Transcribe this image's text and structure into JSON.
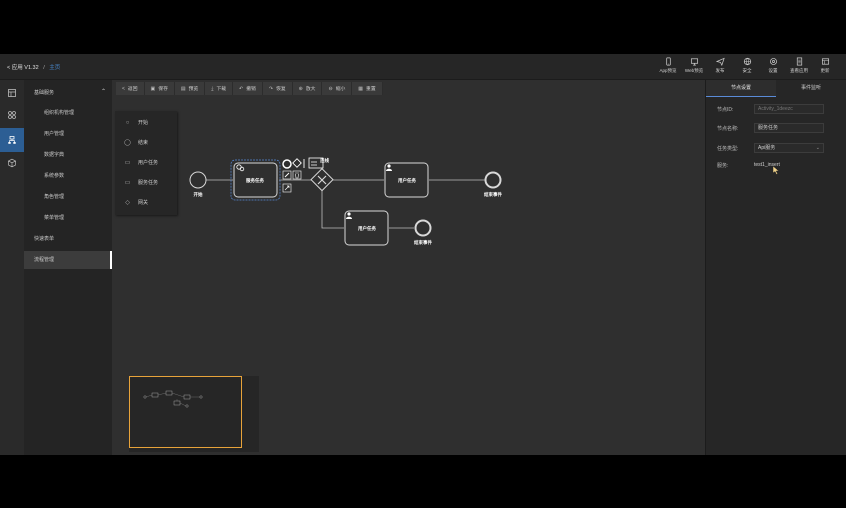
{
  "header": {
    "back_label": "< 应用",
    "version": "V1.32",
    "separator": "/",
    "tag": "主页",
    "buttons": [
      {
        "label": "App预览",
        "icon": "mobile-icon"
      },
      {
        "label": "Web预览",
        "icon": "monitor-icon"
      },
      {
        "label": "发布",
        "icon": "send-icon"
      },
      {
        "label": "安全",
        "icon": "globe-icon"
      },
      {
        "label": "设置",
        "icon": "gear-icon"
      },
      {
        "label": "查看应用",
        "icon": "document-icon"
      },
      {
        "label": "更新",
        "icon": "layout-icon"
      }
    ]
  },
  "menu": {
    "group": "基础服务",
    "items": [
      "组织机构管理",
      "用户管理",
      "数据字典",
      "系统参数",
      "角色管理",
      "菜单管理"
    ],
    "quick": "快速表单",
    "active": "流程管理"
  },
  "toolbar": [
    {
      "label": "返回",
      "icon": "<"
    },
    {
      "label": "保存",
      "icon": "▣"
    },
    {
      "label": "预览",
      "icon": "▤"
    },
    {
      "label": "下载",
      "icon": "⤓"
    },
    {
      "label": "撤销",
      "icon": "↶"
    },
    {
      "label": "恢复",
      "icon": "↷"
    },
    {
      "label": "放大",
      "icon": "⊕"
    },
    {
      "label": "缩小",
      "icon": "⊖"
    },
    {
      "label": "重置",
      "icon": "▦"
    }
  ],
  "palette": [
    {
      "label": "开始",
      "icon": "○"
    },
    {
      "label": "结束",
      "icon": "◯"
    },
    {
      "label": "用户任务",
      "icon": "▭"
    },
    {
      "label": "服务任务",
      "icon": "▭"
    },
    {
      "label": "网关",
      "icon": "◇"
    }
  ],
  "diagram": {
    "start_label": "开始",
    "service_task": "服务任务",
    "user_task_1": "用户任务",
    "user_task_2": "用户任务",
    "end_label_1": "结束事件",
    "end_label_2": "结束事件",
    "context_badge": "连线"
  },
  "props": {
    "tabs": [
      "节点设置",
      "事件监听"
    ],
    "active_tab": "节点设置",
    "fields": {
      "id_label": "节点ID:",
      "id_placeholder": "Activity_1deezc",
      "name_label": "节点名称:",
      "name_value": "服务任务",
      "type_label": "任务类型:",
      "type_value": "Api服务",
      "service_label": "服务:",
      "service_value": "test1_insert"
    }
  },
  "colors": {
    "accent": "#2c5e94",
    "minimap_viewport": "#e8a33a",
    "selection": "#5a8bd8"
  }
}
